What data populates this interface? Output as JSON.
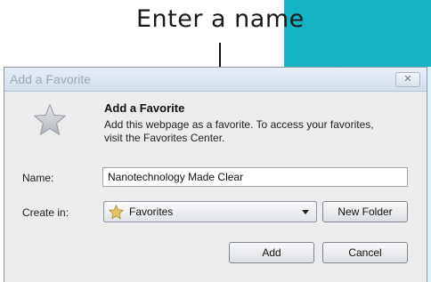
{
  "callout": {
    "label": "Enter a name"
  },
  "dialog": {
    "title": "Add a Favorite",
    "close_label": "✕",
    "heading": "Add a Favorite",
    "description": "Add this webpage as a favorite. To access your favorites, visit the Favorites Center.",
    "name_label": "Name:",
    "name_value": "Nanotechnology Made Clear",
    "create_in_label": "Create in:",
    "create_in_value": "Favorites",
    "new_folder_label": "New Folder",
    "add_label": "Add",
    "cancel_label": "Cancel"
  },
  "icons": {
    "large": "favorite-star-icon",
    "folder": "favorites-folder-star-icon",
    "dropdown": "chevron-down-icon"
  },
  "colors": {
    "teal": "#16b2c5",
    "pale_teal": "#d9f2f5",
    "dialog_bg": "#ececec"
  }
}
